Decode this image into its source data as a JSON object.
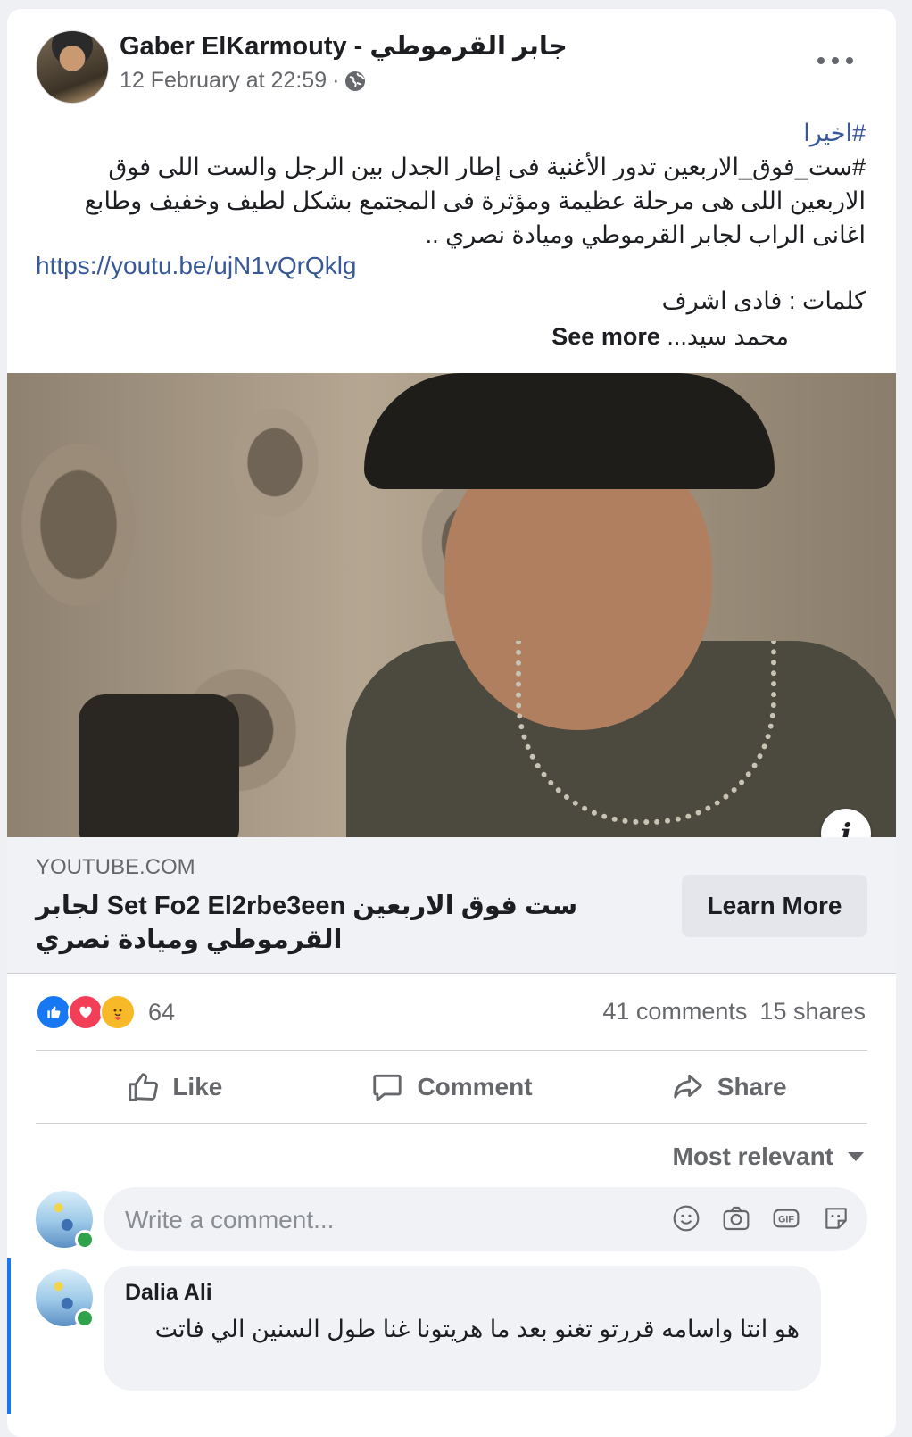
{
  "post": {
    "author": "Gaber ElKarmouty - جابر القرموطي",
    "timestamp": "12 February at 22:59",
    "separator": "·",
    "hashtag": "#اخيرا",
    "body_line1": "#ست_فوق_الاربعين تدور الأغنية فى إطار الجدل بين الرجل والست اللى فوق",
    "body_line2": "الاربعين اللى هى مرحلة عظيمة ومؤثرة فى المجتمع بشكل لطيف وخفيف وطابع",
    "body_line3": "اغانى الراب لجابر القرموطي وميادة نصري ..",
    "link": "https://youtu.be/ujN1vQrQklg",
    "credit_line": "كلمات : فادى اشرف",
    "credit_line2": "محمد سيد...",
    "see_more": "See more"
  },
  "preview": {
    "domain": "YOUTUBE.COM",
    "title": "ست فوق الاربعين Set Fo2 El2rbe3een لجابر القرموطي وميادة نصري",
    "cta": "Learn More",
    "info_icon": "info-icon"
  },
  "stats": {
    "reaction_count": "64",
    "comments": "41 comments",
    "shares": "15 shares",
    "reaction_types": [
      "like",
      "love",
      "care"
    ]
  },
  "actions": {
    "like": "Like",
    "comment": "Comment",
    "share": "Share"
  },
  "sort": {
    "label": "Most relevant"
  },
  "composer": {
    "placeholder": "Write a comment...",
    "icons": [
      "emoji-icon",
      "camera-icon",
      "gif-icon",
      "sticker-icon"
    ]
  },
  "comment": {
    "author": "Dalia Ali",
    "text": "هو انتا واسامه قررتو تغنو بعد ما هريتونا غنا طول السنين الي فاتت"
  },
  "colors": {
    "link": "#385898",
    "like_blue": "#1877f2",
    "love_red": "#f33e58",
    "care_yellow": "#f7b928",
    "secondary_text": "#65676b"
  }
}
